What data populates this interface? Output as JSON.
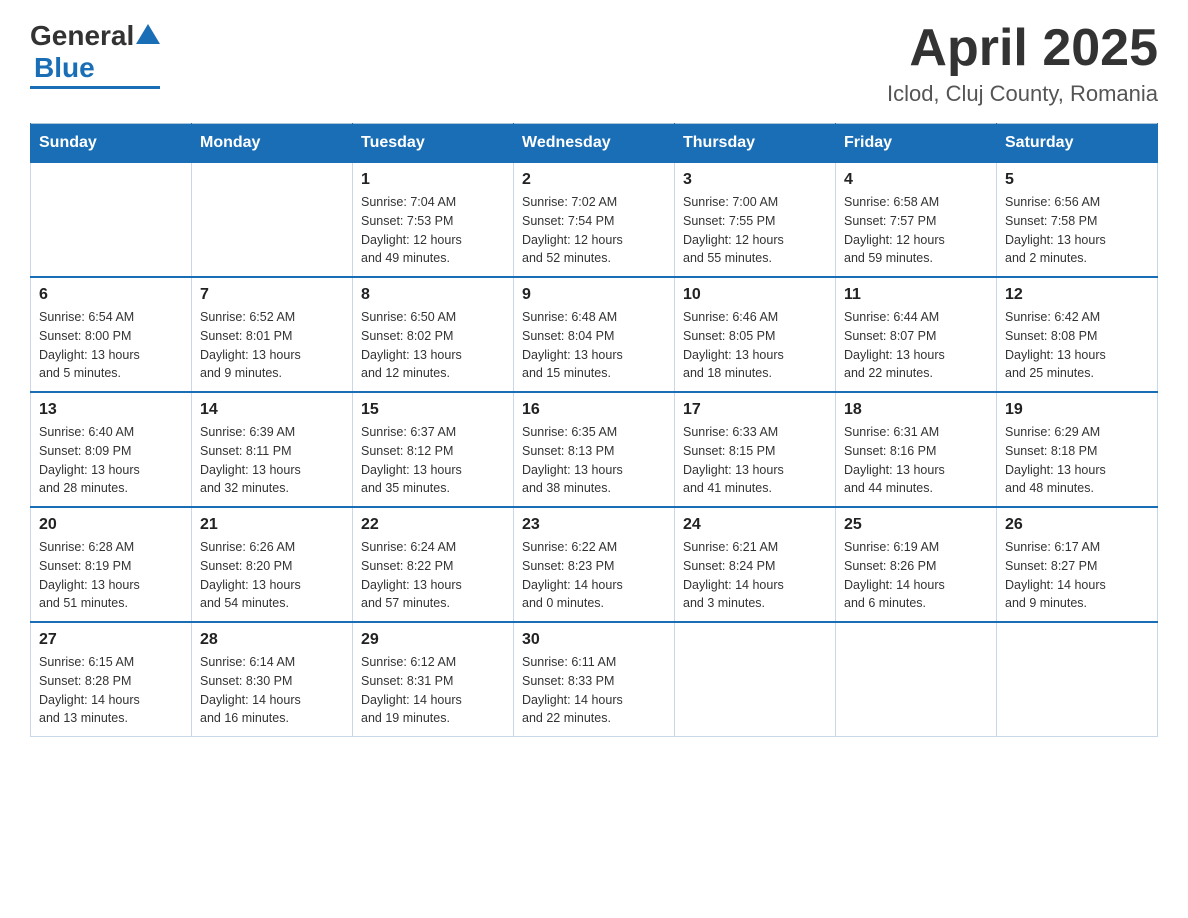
{
  "logo": {
    "general": "General",
    "blue": "Blue"
  },
  "title": "April 2025",
  "subtitle": "Iclod, Cluj County, Romania",
  "days_of_week": [
    "Sunday",
    "Monday",
    "Tuesday",
    "Wednesday",
    "Thursday",
    "Friday",
    "Saturday"
  ],
  "weeks": [
    [
      {
        "day": "",
        "info": ""
      },
      {
        "day": "",
        "info": ""
      },
      {
        "day": "1",
        "info": "Sunrise: 7:04 AM\nSunset: 7:53 PM\nDaylight: 12 hours\nand 49 minutes."
      },
      {
        "day": "2",
        "info": "Sunrise: 7:02 AM\nSunset: 7:54 PM\nDaylight: 12 hours\nand 52 minutes."
      },
      {
        "day": "3",
        "info": "Sunrise: 7:00 AM\nSunset: 7:55 PM\nDaylight: 12 hours\nand 55 minutes."
      },
      {
        "day": "4",
        "info": "Sunrise: 6:58 AM\nSunset: 7:57 PM\nDaylight: 12 hours\nand 59 minutes."
      },
      {
        "day": "5",
        "info": "Sunrise: 6:56 AM\nSunset: 7:58 PM\nDaylight: 13 hours\nand 2 minutes."
      }
    ],
    [
      {
        "day": "6",
        "info": "Sunrise: 6:54 AM\nSunset: 8:00 PM\nDaylight: 13 hours\nand 5 minutes."
      },
      {
        "day": "7",
        "info": "Sunrise: 6:52 AM\nSunset: 8:01 PM\nDaylight: 13 hours\nand 9 minutes."
      },
      {
        "day": "8",
        "info": "Sunrise: 6:50 AM\nSunset: 8:02 PM\nDaylight: 13 hours\nand 12 minutes."
      },
      {
        "day": "9",
        "info": "Sunrise: 6:48 AM\nSunset: 8:04 PM\nDaylight: 13 hours\nand 15 minutes."
      },
      {
        "day": "10",
        "info": "Sunrise: 6:46 AM\nSunset: 8:05 PM\nDaylight: 13 hours\nand 18 minutes."
      },
      {
        "day": "11",
        "info": "Sunrise: 6:44 AM\nSunset: 8:07 PM\nDaylight: 13 hours\nand 22 minutes."
      },
      {
        "day": "12",
        "info": "Sunrise: 6:42 AM\nSunset: 8:08 PM\nDaylight: 13 hours\nand 25 minutes."
      }
    ],
    [
      {
        "day": "13",
        "info": "Sunrise: 6:40 AM\nSunset: 8:09 PM\nDaylight: 13 hours\nand 28 minutes."
      },
      {
        "day": "14",
        "info": "Sunrise: 6:39 AM\nSunset: 8:11 PM\nDaylight: 13 hours\nand 32 minutes."
      },
      {
        "day": "15",
        "info": "Sunrise: 6:37 AM\nSunset: 8:12 PM\nDaylight: 13 hours\nand 35 minutes."
      },
      {
        "day": "16",
        "info": "Sunrise: 6:35 AM\nSunset: 8:13 PM\nDaylight: 13 hours\nand 38 minutes."
      },
      {
        "day": "17",
        "info": "Sunrise: 6:33 AM\nSunset: 8:15 PM\nDaylight: 13 hours\nand 41 minutes."
      },
      {
        "day": "18",
        "info": "Sunrise: 6:31 AM\nSunset: 8:16 PM\nDaylight: 13 hours\nand 44 minutes."
      },
      {
        "day": "19",
        "info": "Sunrise: 6:29 AM\nSunset: 8:18 PM\nDaylight: 13 hours\nand 48 minutes."
      }
    ],
    [
      {
        "day": "20",
        "info": "Sunrise: 6:28 AM\nSunset: 8:19 PM\nDaylight: 13 hours\nand 51 minutes."
      },
      {
        "day": "21",
        "info": "Sunrise: 6:26 AM\nSunset: 8:20 PM\nDaylight: 13 hours\nand 54 minutes."
      },
      {
        "day": "22",
        "info": "Sunrise: 6:24 AM\nSunset: 8:22 PM\nDaylight: 13 hours\nand 57 minutes."
      },
      {
        "day": "23",
        "info": "Sunrise: 6:22 AM\nSunset: 8:23 PM\nDaylight: 14 hours\nand 0 minutes."
      },
      {
        "day": "24",
        "info": "Sunrise: 6:21 AM\nSunset: 8:24 PM\nDaylight: 14 hours\nand 3 minutes."
      },
      {
        "day": "25",
        "info": "Sunrise: 6:19 AM\nSunset: 8:26 PM\nDaylight: 14 hours\nand 6 minutes."
      },
      {
        "day": "26",
        "info": "Sunrise: 6:17 AM\nSunset: 8:27 PM\nDaylight: 14 hours\nand 9 minutes."
      }
    ],
    [
      {
        "day": "27",
        "info": "Sunrise: 6:15 AM\nSunset: 8:28 PM\nDaylight: 14 hours\nand 13 minutes."
      },
      {
        "day": "28",
        "info": "Sunrise: 6:14 AM\nSunset: 8:30 PM\nDaylight: 14 hours\nand 16 minutes."
      },
      {
        "day": "29",
        "info": "Sunrise: 6:12 AM\nSunset: 8:31 PM\nDaylight: 14 hours\nand 19 minutes."
      },
      {
        "day": "30",
        "info": "Sunrise: 6:11 AM\nSunset: 8:33 PM\nDaylight: 14 hours\nand 22 minutes."
      },
      {
        "day": "",
        "info": ""
      },
      {
        "day": "",
        "info": ""
      },
      {
        "day": "",
        "info": ""
      }
    ]
  ]
}
